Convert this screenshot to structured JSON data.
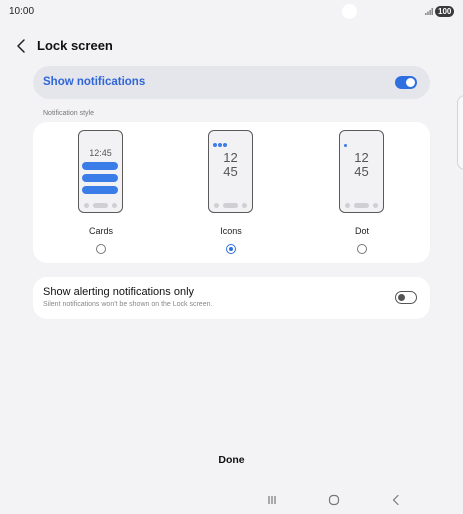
{
  "status_bar": {
    "time": "10:00",
    "battery": "100"
  },
  "header": {
    "title": "Lock screen"
  },
  "show_notifications": {
    "label": "Show notifications",
    "enabled": true
  },
  "notification_style": {
    "section_label": "Notification style",
    "options": [
      {
        "label": "Cards",
        "clock": "12:45",
        "selected": false
      },
      {
        "label": "Icons",
        "clock_hour": "12",
        "clock_minute": "45",
        "selected": true
      },
      {
        "label": "Dot",
        "clock_hour": "12",
        "clock_minute": "45",
        "selected": false
      }
    ]
  },
  "alerting_only": {
    "label": "Show alerting notifications only",
    "description": "Silent notifications won't be shown on the Lock screen.",
    "enabled": false
  },
  "footer": {
    "done_label": "Done"
  },
  "colors": {
    "accent": "#2f6fe0",
    "background": "#f3f3f5",
    "card": "#ffffff"
  },
  "icons": {
    "back": "chevron-left-icon",
    "nav_recents": "recents-icon",
    "nav_home": "home-icon",
    "nav_back": "back-icon"
  }
}
